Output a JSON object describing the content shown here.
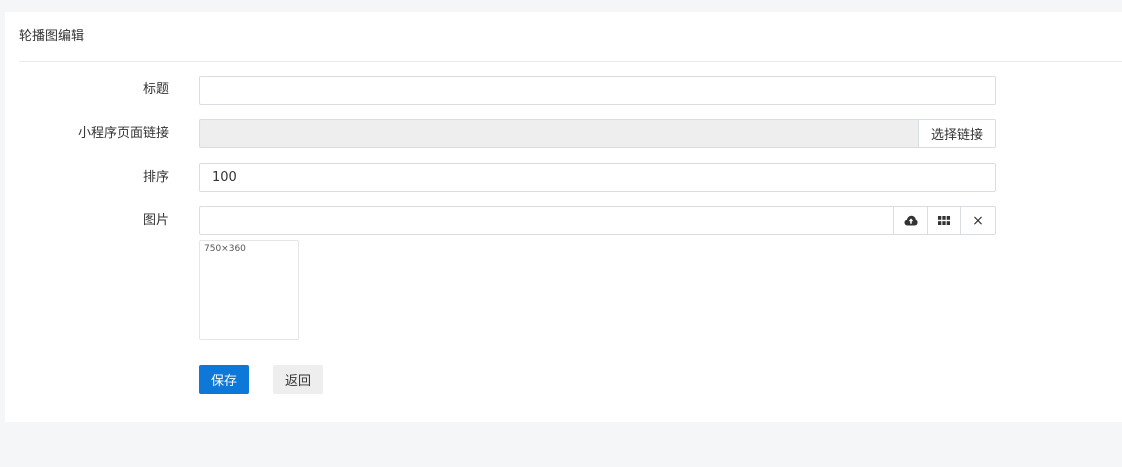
{
  "header": {
    "title": "轮播图编辑"
  },
  "form": {
    "title": {
      "label": "标题",
      "value": ""
    },
    "page_link": {
      "label": "小程序页面链接",
      "value": "",
      "select_button": "选择链接"
    },
    "sort": {
      "label": "排序",
      "value": "100"
    },
    "image": {
      "label": "图片",
      "value": "",
      "thumb_text": "750×360",
      "icons": [
        "upload-cloud-icon",
        "grid-icon",
        "close-icon"
      ],
      "remove_glyph": "×"
    }
  },
  "actions": {
    "save": "保存",
    "back": "返回"
  },
  "colors": {
    "primary": "#0e78d8",
    "page_bg": "#f5f6f8"
  }
}
